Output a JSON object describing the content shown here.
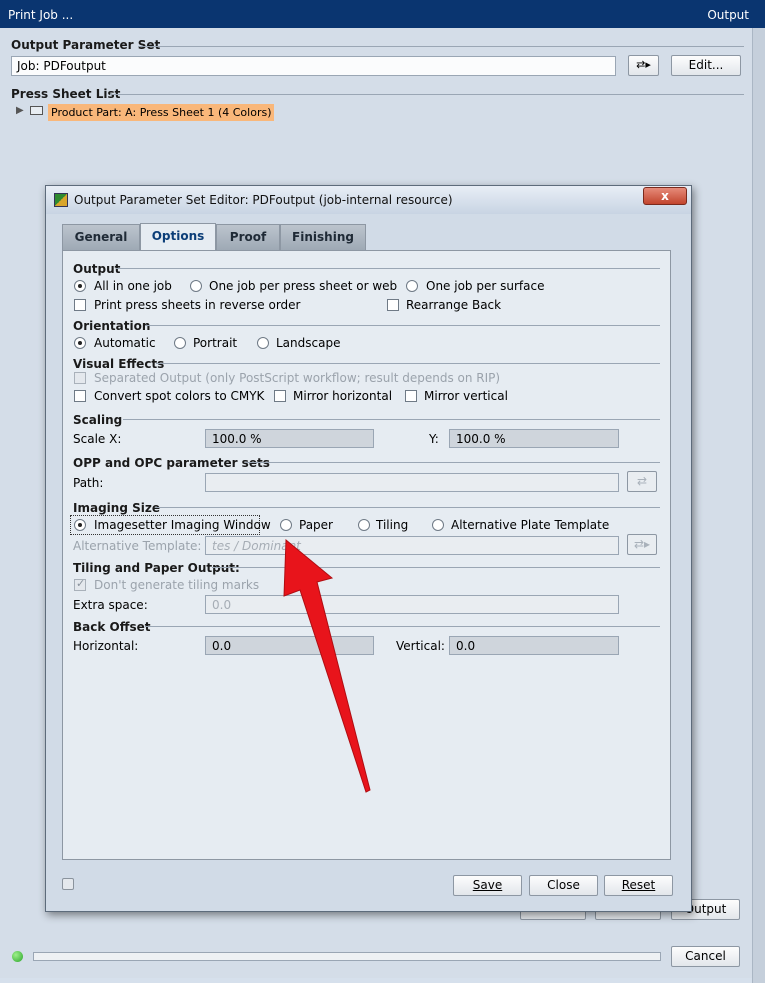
{
  "window": {
    "title": "Print Job ...",
    "title_right": "Output"
  },
  "output_parameter_set": {
    "heading": "Output Parameter Set",
    "value": "Job: PDFoutput",
    "edit_label": "Edit..."
  },
  "press_sheet_list": {
    "heading": "Press Sheet List",
    "item": "Product Part: A: Press Sheet 1 (4 Colors)"
  },
  "main_buttons": {
    "output_label": "Output",
    "cancel_label": "Cancel"
  },
  "dialog": {
    "title": "Output Parameter Set Editor: PDFoutput (job-internal resource)",
    "close_glyph": "x",
    "tabs": [
      {
        "label": "General",
        "active": false
      },
      {
        "label": "Options",
        "active": true
      },
      {
        "label": "Proof",
        "active": false
      },
      {
        "label": "Finishing",
        "active": false
      }
    ],
    "output": {
      "heading": "Output",
      "opt_all": "All in one job",
      "opt_per_sheet": "One job per press sheet or web",
      "opt_per_surface": "One job per surface",
      "reverse_order": "Print press sheets in reverse order",
      "rearrange_back": "Rearrange Back"
    },
    "orientation": {
      "heading": "Orientation",
      "automatic": "Automatic",
      "portrait": "Portrait",
      "landscape": "Landscape"
    },
    "visual_effects": {
      "heading": "Visual Effects",
      "separated": "Separated Output (only PostScript workflow; result depends on RIP)",
      "spot_to_cmyk": "Convert spot colors to CMYK",
      "mirror_h": "Mirror horizontal",
      "mirror_v": "Mirror vertical"
    },
    "scaling": {
      "heading": "Scaling",
      "x_label": "Scale X:",
      "x_value": "100.0 %",
      "y_label": "Y:",
      "y_value": "100.0 %"
    },
    "opp": {
      "heading": "OPP and OPC parameter sets",
      "path_label": "Path:",
      "path_value": ""
    },
    "imaging_size": {
      "heading": "Imaging Size",
      "imagesetter": "Imagesetter Imaging Window",
      "paper": "Paper",
      "tiling": "Tiling",
      "alt_plate": "Alternative Plate Template",
      "alt_template_label": "Alternative Template:",
      "alt_template_value": "tes / Dominant"
    },
    "tiling_paper": {
      "heading": "Tiling and Paper Output:",
      "no_marks": "Don't generate tiling marks",
      "extra_label": "Extra space:",
      "extra_value": "0.0"
    },
    "back_offset": {
      "heading": "Back Offset",
      "h_label": "Horizontal:",
      "h_value": "0.0",
      "v_label": "Vertical:",
      "v_value": "0.0"
    },
    "buttons": {
      "save": "Save",
      "close": "Close",
      "reset": "Reset"
    }
  },
  "annotation": {
    "color": "#e8141b"
  }
}
